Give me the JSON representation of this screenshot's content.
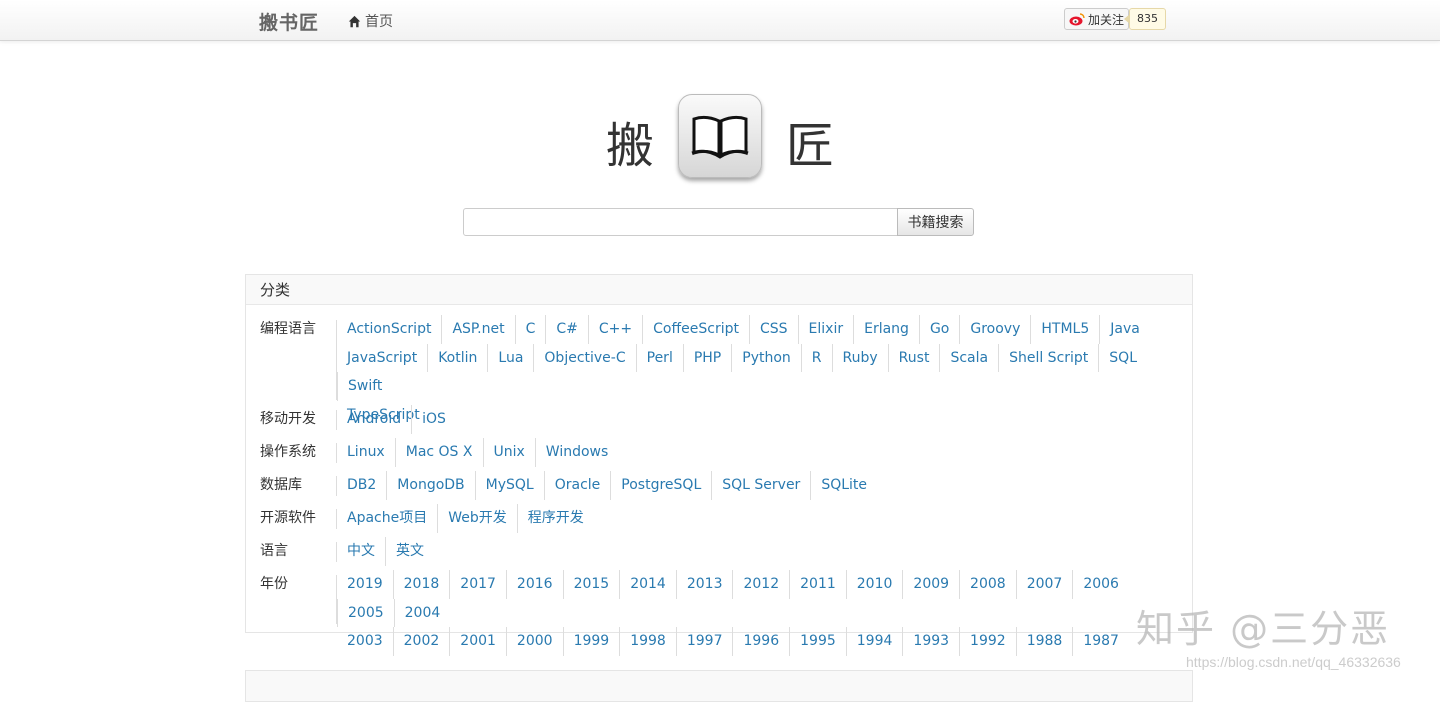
{
  "navbar": {
    "brand": "搬书匠",
    "home_label": "首页",
    "follow_label": "加关注",
    "follow_count": "835"
  },
  "logo": {
    "left_char": "搬",
    "right_char": "匠"
  },
  "search": {
    "value": "",
    "button_label": "书籍搜索"
  },
  "categories": {
    "title": "分类",
    "rows": [
      {
        "label": "编程语言",
        "items": [
          "ActionScript",
          "ASP.net",
          "C",
          "C#",
          "C++",
          "CoffeeScript",
          "CSS",
          "Elixir",
          "Erlang",
          "Go",
          "Groovy",
          "HTML5",
          "Java",
          "JavaScript",
          "Kotlin",
          "Lua",
          "Objective-C",
          "Perl",
          "PHP",
          "Python",
          "R",
          "Ruby",
          "Rust",
          "Scala",
          "Shell Script",
          "SQL",
          "Swift",
          "TypeScript"
        ]
      },
      {
        "label": "移动开发",
        "items": [
          "Android",
          "iOS"
        ]
      },
      {
        "label": "操作系统",
        "items": [
          "Linux",
          "Mac OS X",
          "Unix",
          "Windows"
        ]
      },
      {
        "label": "数据库",
        "items": [
          "DB2",
          "MongoDB",
          "MySQL",
          "Oracle",
          "PostgreSQL",
          "SQL Server",
          "SQLite"
        ]
      },
      {
        "label": "开源软件",
        "items": [
          "Apache项目",
          "Web开发",
          "程序开发"
        ]
      },
      {
        "label": "语言",
        "items": [
          "中文",
          "英文"
        ]
      },
      {
        "label": "年份",
        "items": [
          "2019",
          "2018",
          "2017",
          "2016",
          "2015",
          "2014",
          "2013",
          "2012",
          "2011",
          "2010",
          "2009",
          "2008",
          "2007",
          "2006",
          "2005",
          "2004",
          "2003",
          "2002",
          "2001",
          "2000",
          "1999",
          "1998",
          "1997",
          "1996",
          "1995",
          "1994",
          "1993",
          "1992",
          "1988",
          "1987"
        ]
      }
    ]
  },
  "watermark": {
    "text": "知乎 @三分恶",
    "url": "https://blog.csdn.net/qq_46332636"
  },
  "colors": {
    "link": "#2a7ab0",
    "weibo_red": "#e6162d"
  }
}
